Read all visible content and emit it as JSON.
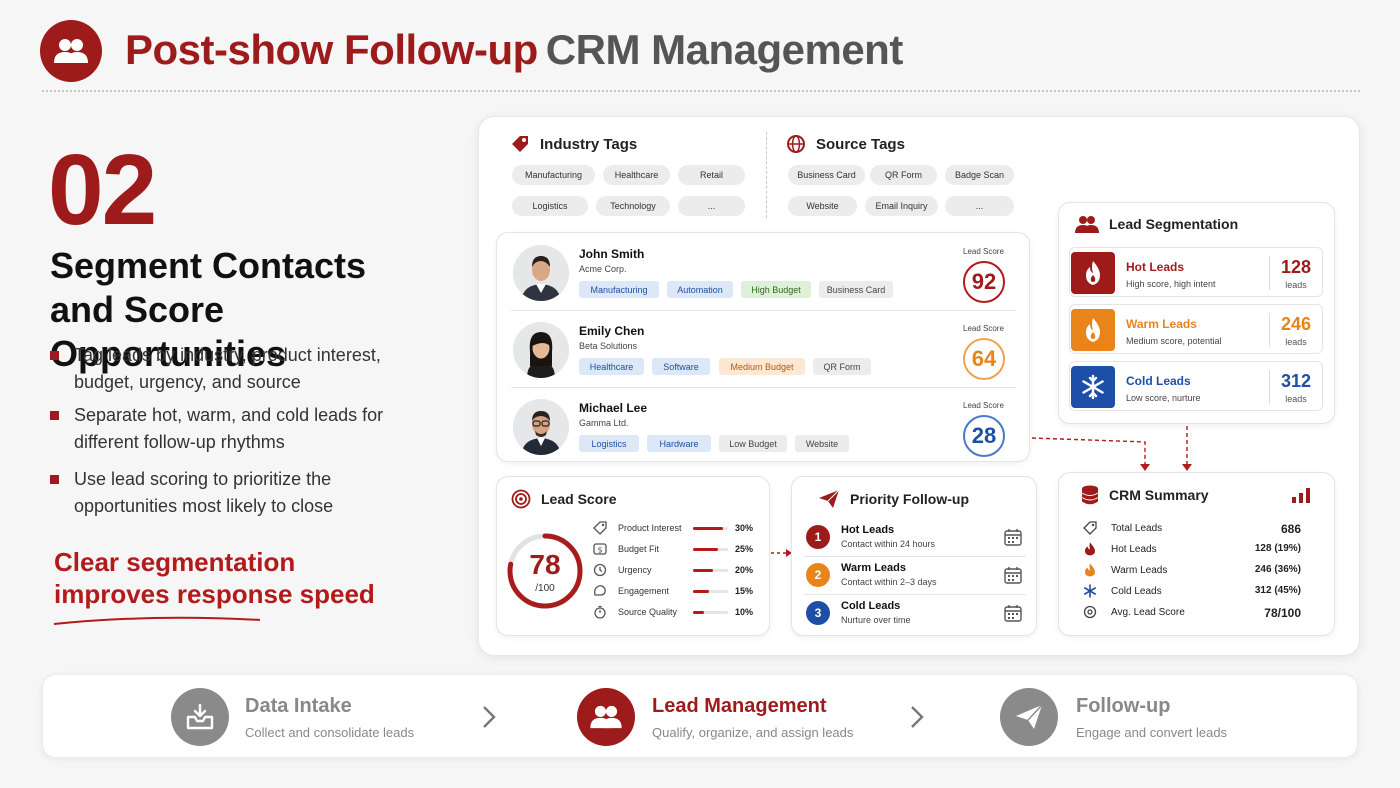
{
  "header": {
    "title": "Post-show Follow-up",
    "subtitle": "CRM Management",
    "icon": "users-icon"
  },
  "left": {
    "step_number": "02",
    "section_title": "Segment Contacts and Score Opportunities",
    "bullets": [
      "Tag leads by industry, product interest, budget, urgency, and source",
      "Separate hot, warm, and cold leads for different follow-up rhythms",
      "Use lead scoring to prioritize the opportunities most likely to close"
    ],
    "highlight": "Clear segmentation improves response speed"
  },
  "industry_tags": {
    "title": "Industry Tags",
    "icon": "tag-icon",
    "chips": [
      "Manufacturing",
      "Healthcare",
      "Retail",
      "Logistics",
      "Technology",
      "..."
    ]
  },
  "source_tags": {
    "title": "Source Tags",
    "icon": "globe-icon",
    "chips": [
      "Business Card",
      "QR Form",
      "Badge Scan",
      "Website",
      "Email Inquiry",
      "..."
    ]
  },
  "leads": {
    "score_label": "Lead Score",
    "rows": [
      {
        "name": "John Smith",
        "company": "Acme Corp.",
        "tags": [
          "Manufacturing",
          "Automation",
          "High Budget",
          "Business Card"
        ],
        "score": "92"
      },
      {
        "name": "Emily Chen",
        "company": "Beta Solutions",
        "tags": [
          "Healthcare",
          "Software",
          "Medium Budget",
          "QR Form"
        ],
        "score": "64"
      },
      {
        "name": "Michael Lee",
        "company": "Gamma Ltd.",
        "tags": [
          "Logistics",
          "Hardware",
          "Low Budget",
          "Website"
        ],
        "score": "28"
      }
    ]
  },
  "segmentation": {
    "title": "Lead Segmentation",
    "icon": "users-icon",
    "rows": [
      {
        "name": "Hot Leads",
        "desc": "High score, high intent",
        "count": "128",
        "unit": "leads",
        "color": "#9e1b1b",
        "icon": "fire-icon"
      },
      {
        "name": "Warm Leads",
        "desc": "Medium score, potential",
        "count": "246",
        "unit": "leads",
        "color": "#e8841a",
        "icon": "flame-icon"
      },
      {
        "name": "Cold Leads",
        "desc": "Low score, nurture",
        "count": "312",
        "unit": "leads",
        "color": "#1e4fa8",
        "icon": "snowflake-icon"
      }
    ]
  },
  "lead_score": {
    "title": "Lead Score",
    "icon": "target-icon",
    "value": "78",
    "max": "/100",
    "fraction": 0.78,
    "factors": [
      {
        "label": "Product Interest",
        "pct": "30%",
        "fill": 0.85,
        "icon": "tag-icon"
      },
      {
        "label": "Budget Fit",
        "pct": "25%",
        "fill": 0.72,
        "icon": "dollar-icon"
      },
      {
        "label": "Urgency",
        "pct": "20%",
        "fill": 0.58,
        "icon": "clock-icon"
      },
      {
        "label": "Engagement",
        "pct": "15%",
        "fill": 0.45,
        "icon": "chat-icon"
      },
      {
        "label": "Source Quality",
        "pct": "10%",
        "fill": 0.32,
        "icon": "stopwatch-icon"
      }
    ]
  },
  "priority": {
    "title": "Priority Follow-up",
    "icon": "paper-plane-icon",
    "rows": [
      {
        "num": "1",
        "name": "Hot Leads",
        "desc": "Contact within 24 hours",
        "color": "#9e1b1b"
      },
      {
        "num": "2",
        "name": "Warm Leads",
        "desc": "Contact within 2–3 days",
        "color": "#e8841a"
      },
      {
        "num": "3",
        "name": "Cold Leads",
        "desc": "Nurture over time",
        "color": "#1e4fa8"
      }
    ]
  },
  "summary": {
    "title": "CRM Summary",
    "icon": "database-icon",
    "rows": [
      {
        "label": "Total Leads",
        "value": "686",
        "icon": "tag-icon"
      },
      {
        "label": "Hot Leads",
        "value": "128 (19%)",
        "icon": "fire-icon"
      },
      {
        "label": "Warm Leads",
        "value": "246 (36%)",
        "icon": "flame-icon"
      },
      {
        "label": "Cold Leads",
        "value": "312 (45%)",
        "icon": "snowflake-icon"
      },
      {
        "label": "Avg. Lead Score",
        "value": "78/100",
        "icon": "gauge-icon"
      }
    ]
  },
  "footer": {
    "steps": [
      {
        "title": "Data Intake",
        "desc": "Collect and consolidate leads",
        "active": false,
        "icon": "inbox-icon"
      },
      {
        "title": "Lead Management",
        "desc": "Qualify, organize, and assign leads",
        "active": true,
        "icon": "users-icon"
      },
      {
        "title": "Follow-up",
        "desc": "Engage and convert leads",
        "active": false,
        "icon": "paper-plane-icon"
      }
    ]
  },
  "colors": {
    "brand_red": "#9e1b1b",
    "warm_orange": "#e8841a",
    "cold_blue": "#1e4fa8",
    "muted_gray": "#888888"
  }
}
